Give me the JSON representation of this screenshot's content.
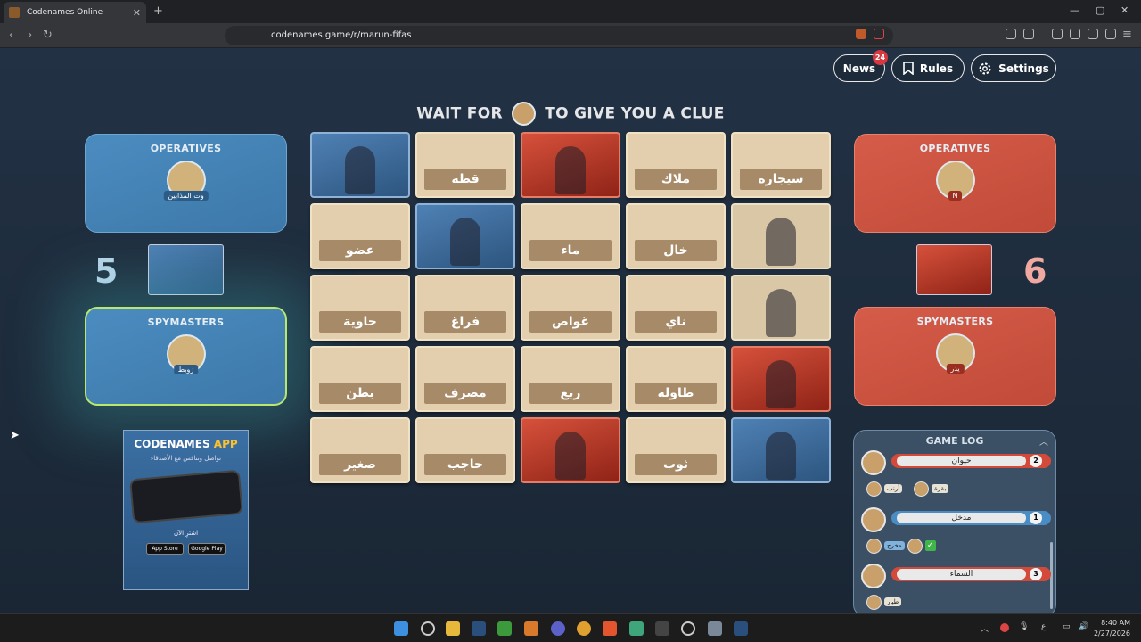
{
  "browser": {
    "tab_title": "Codenames Online",
    "tab_close": "✕",
    "new_tab": "+",
    "url": "codenames.game/r/marun-fifas"
  },
  "header": {
    "news_label": "News",
    "news_badge": "24",
    "rules_label": "Rules",
    "settings_label": "Settings"
  },
  "clue_banner": {
    "prefix": "WAIT FOR",
    "suffix": "TO GIVE YOU A CLUE",
    "spymaster_name": "زوبط"
  },
  "blue_team": {
    "operatives_title": "OPERATIVES",
    "operative_name": "وت المذابين",
    "remaining": "5",
    "spymasters_title": "SPYMASTERS",
    "spymaster_name": "زوبط",
    "color": "#4b8cc0"
  },
  "red_team": {
    "operatives_title": "OPERATIVES",
    "operative_name": "N",
    "remaining": "6",
    "spymasters_title": "SPYMASTERS",
    "spymaster_name": "يدر",
    "color": "#d55c49"
  },
  "board": [
    {
      "word": "",
      "state": "blue"
    },
    {
      "word": "قطة",
      "state": "hidden"
    },
    {
      "word": "",
      "state": "red"
    },
    {
      "word": "ملاك",
      "state": "hidden"
    },
    {
      "word": "سيجارة",
      "state": "hidden"
    },
    {
      "word": "عضو",
      "state": "hidden"
    },
    {
      "word": "",
      "state": "blue"
    },
    {
      "word": "ماء",
      "state": "hidden"
    },
    {
      "word": "خال",
      "state": "hidden"
    },
    {
      "word": "",
      "state": "neutral"
    },
    {
      "word": "حاوية",
      "state": "hidden"
    },
    {
      "word": "فراغ",
      "state": "hidden"
    },
    {
      "word": "غواص",
      "state": "hidden"
    },
    {
      "word": "ناي",
      "state": "hidden"
    },
    {
      "word": "",
      "state": "neutral"
    },
    {
      "word": "بطن",
      "state": "hidden"
    },
    {
      "word": "مصرف",
      "state": "hidden"
    },
    {
      "word": "ربع",
      "state": "hidden"
    },
    {
      "word": "طاولة",
      "state": "hidden"
    },
    {
      "word": "",
      "state": "red"
    },
    {
      "word": "صغير",
      "state": "hidden"
    },
    {
      "word": "حاجب",
      "state": "hidden"
    },
    {
      "word": "",
      "state": "red"
    },
    {
      "word": "ثوب",
      "state": "hidden"
    },
    {
      "word": "",
      "state": "blue"
    }
  ],
  "promo": {
    "title_main": "CODENAMES",
    "title_accent": "APP",
    "subtitle": "تواصل وتنافس مع الأصدقاء",
    "download": "اشترِ الآن",
    "app_store": "App Store",
    "google_play": "Google Play"
  },
  "game_log": {
    "title": "GAME LOG",
    "entries": [
      {
        "clue": "حيوان",
        "number": "2",
        "team": "red",
        "guesses": [
          "أرنب",
          "بقرة"
        ]
      },
      {
        "clue": "مدخل",
        "number": "1",
        "team": "blue",
        "guesses": [
          "مخرج"
        ]
      },
      {
        "clue": "السماء",
        "number": "3",
        "team": "red",
        "guesses": [
          "طيار"
        ]
      }
    ]
  },
  "taskbar": {
    "time": "8:40 AM",
    "date": "2/27/2026"
  }
}
